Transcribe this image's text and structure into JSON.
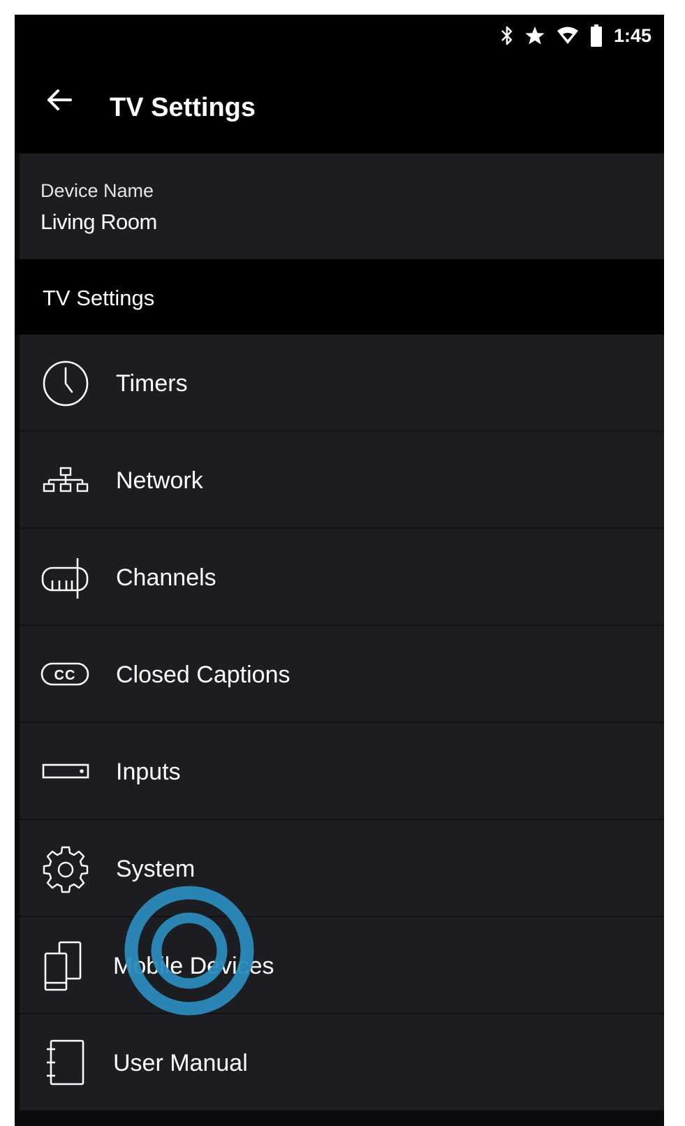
{
  "status_bar": {
    "icons": [
      "bluetooth-icon",
      "star-icon",
      "wifi-icon",
      "battery-icon"
    ],
    "time": "1:45"
  },
  "app_bar": {
    "back_icon": "arrow-left-icon",
    "title": "TV Settings"
  },
  "device": {
    "label": "Device Name",
    "value": "Living Room"
  },
  "section": {
    "title": "TV Settings"
  },
  "menu": {
    "items": [
      {
        "label": "Timers",
        "icon": "clock-icon"
      },
      {
        "label": "Network",
        "icon": "network-icon"
      },
      {
        "label": "Channels",
        "icon": "antenna-icon"
      },
      {
        "label": "Closed Captions",
        "icon": "cc-icon"
      },
      {
        "label": "Inputs",
        "icon": "input-port-icon"
      },
      {
        "label": "System",
        "icon": "gear-icon"
      },
      {
        "label": "Mobile Devices",
        "icon": "mobile-devices-icon"
      },
      {
        "label": "User Manual",
        "icon": "manual-icon"
      }
    ]
  },
  "colors": {
    "background": "#0a0b0c",
    "bar": "#000000",
    "row": "#1b1d20",
    "text": "#ffffff",
    "touch_indicator": "#2b8bbd"
  }
}
